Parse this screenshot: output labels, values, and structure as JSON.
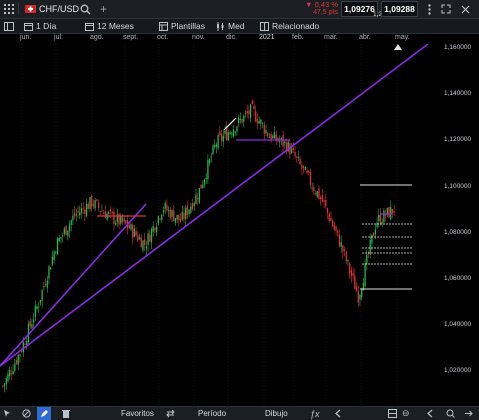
{
  "header": {
    "symbol": "CHF/USD",
    "change_pct": "0,43 %",
    "change_pts": "47,5 pts",
    "bid": "1,09276",
    "spread": "1,2",
    "ask": "1,09288"
  },
  "toolbar": {
    "interval": "1 Día",
    "range": "12 Meses",
    "templates": "Plantillas",
    "style": "Med",
    "related": "Relacionado"
  },
  "months": [
    "jun.",
    "jul.",
    "ago.",
    "sept.",
    "oct.",
    "nov.",
    "dic.",
    "2021",
    "feb.",
    "mar.",
    "abr.",
    "may."
  ],
  "y_ticks": [
    "1,160000",
    "1,140000",
    "1,120000",
    "1,100000",
    "1,080000",
    "1,060000",
    "1,040000",
    "1,020000"
  ],
  "bottom": {
    "favorites": "Favoritos",
    "period": "Período",
    "drawing": "Dibujo"
  },
  "colors": {
    "up": "#2db34a",
    "down": "#e0313a",
    "trendline": "#8a2be2",
    "level": "#e2e2e2",
    "accent_red": "#e0313a"
  },
  "chart_data": {
    "type": "candlestick",
    "ylim": [
      1.012,
      1.165
    ],
    "close_path": [
      [
        "jun.",
        1.02
      ],
      [
        "jun.",
        1.035
      ],
      [
        "jul.",
        1.055
      ],
      [
        "jul.",
        1.08
      ],
      [
        "ago.",
        1.092
      ],
      [
        "ago.",
        1.098
      ],
      [
        "sept.",
        1.092
      ],
      [
        "sept.",
        1.088
      ],
      [
        "oct.",
        1.08
      ],
      [
        "oct.",
        1.096
      ],
      [
        "nov.",
        1.09
      ],
      [
        "nov.",
        1.102
      ],
      [
        "dic.",
        1.123
      ],
      [
        "dic.",
        1.13
      ],
      [
        "2021",
        1.137
      ],
      [
        "2021",
        1.126
      ],
      [
        "feb.",
        1.122
      ],
      [
        "feb.",
        1.11
      ],
      [
        "mar.",
        1.098
      ],
      [
        "mar.",
        1.08
      ],
      [
        "abr.",
        1.058
      ],
      [
        "abr.",
        1.09
      ],
      [
        "may.",
        1.095
      ]
    ]
  }
}
